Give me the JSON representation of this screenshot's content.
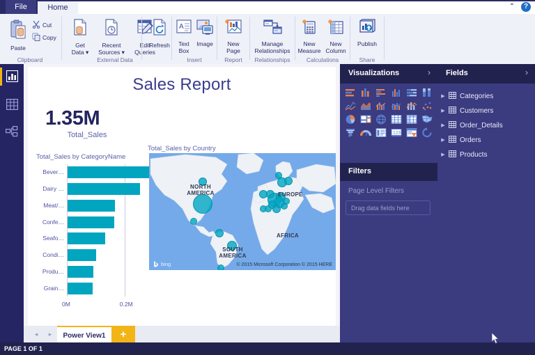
{
  "window": {
    "tabs": [
      {
        "label": "File",
        "name": "tab-file"
      },
      {
        "label": "Home",
        "name": "tab-home"
      }
    ],
    "collapse_icon": "chevron-up-icon",
    "collapse_glyph": "⌃",
    "help_icon": "help-icon",
    "help_glyph": "?"
  },
  "ribbon": {
    "groups": [
      {
        "label": "Clipboard",
        "commands": [
          {
            "label": "Paste",
            "icon": "paste-icon"
          },
          {
            "label": "Cut",
            "icon": "cut-icon"
          },
          {
            "label": "Copy",
            "icon": "copy-icon"
          }
        ]
      },
      {
        "label": "External Data",
        "commands": [
          {
            "label": "Get\nData ▾",
            "icon": "get-data-icon"
          },
          {
            "label": "Recent\nSources ▾",
            "icon": "recent-sources-icon"
          },
          {
            "label": "Edit\nQueries",
            "icon": "edit-queries-icon"
          },
          {
            "label": "Refresh",
            "icon": "refresh-icon"
          }
        ]
      },
      {
        "label": "Insert",
        "commands": [
          {
            "label": "Text\nBox",
            "icon": "text-box-icon"
          },
          {
            "label": "Image",
            "icon": "image-icon"
          }
        ]
      },
      {
        "label": "Report",
        "commands": [
          {
            "label": "New\nPage",
            "icon": "new-page-icon"
          }
        ]
      },
      {
        "label": "Relationships",
        "commands": [
          {
            "label": "Manage\nRelationships",
            "icon": "manage-relationships-icon"
          }
        ]
      },
      {
        "label": "Calculations",
        "commands": [
          {
            "label": "New\nMeasure",
            "icon": "new-measure-icon"
          },
          {
            "label": "New\nColumn",
            "icon": "new-column-icon"
          }
        ]
      },
      {
        "label": "Share",
        "commands": [
          {
            "label": "Publish",
            "icon": "publish-icon"
          }
        ]
      }
    ],
    "labels": {
      "paste": "Paste",
      "cut": "Cut",
      "copy": "Copy",
      "clipboard": "Clipboard",
      "get_data": "Get\nData ▾",
      "recent_sources": "Recent\nSources ▾",
      "edit_queries": "Edit\nQueries",
      "refresh": "Refresh",
      "external_data": "External Data",
      "text_box": "Text\nBox",
      "image": "Image",
      "insert": "Insert",
      "new_page": "New\nPage",
      "report": "Report",
      "manage_relationships": "Manage\nRelationships",
      "relationships": "Relationships",
      "new_measure": "New\nMeasure",
      "new_column": "New\nColumn",
      "calculations": "Calculations",
      "publish": "Publish",
      "share": "Share"
    }
  },
  "left_rail": {
    "items": [
      {
        "name": "report-view",
        "icon": "bar-chart-icon",
        "selected": true
      },
      {
        "name": "data-view",
        "icon": "table-icon",
        "selected": false
      },
      {
        "name": "relationships-view",
        "icon": "relationships-diagram-icon",
        "selected": false
      }
    ]
  },
  "report": {
    "title": "Sales Report",
    "kpi": {
      "value": "1.35M",
      "caption": "Total_Sales"
    },
    "map": {
      "title": "Total_Sales by Country",
      "bing_label": "bing",
      "attribution": "© 2015 Microsoft Corporation     © 2015 HERE",
      "continents": [
        "NORTH\nAMERICA",
        "SOUTH\nAMERICA",
        "AFRICA",
        "EUROPE"
      ]
    }
  },
  "chart_data": {
    "type": "bar",
    "orientation": "horizontal",
    "title": "Total_Sales by CategoryName",
    "xlabel": "",
    "ylabel": "",
    "categories": [
      "Bever…",
      "Dairy …",
      "Meat/…",
      "Confe…",
      "Seafo…",
      "Condi…",
      "Produ…",
      "Grain…"
    ],
    "full_categories": [
      "Beverages",
      "Dairy Products",
      "Meat/Poultry",
      "Confections",
      "Seafood",
      "Condiments",
      "Produce",
      "Grains/Cereals"
    ],
    "values": [
      0.286,
      0.251,
      0.164,
      0.163,
      0.131,
      0.1,
      0.089,
      0.086
    ],
    "value_unit": "M",
    "xlim": [
      0,
      0.29
    ],
    "tick_values": [
      0,
      0.2
    ],
    "tick_labels": [
      "0M",
      "0.2M"
    ],
    "grid": true,
    "bar_color": "#01a5c0",
    "series": [
      {
        "name": "Total_Sales",
        "values": [
          0.286,
          0.251,
          0.164,
          0.163,
          0.131,
          0.1,
          0.089,
          0.086
        ]
      }
    ]
  },
  "map_data": {
    "type": "scatter",
    "title": "Total_Sales by Country",
    "bubble_color": "#00a6c3",
    "bubbles": [
      {
        "x": 76,
        "y": 72,
        "r": 13,
        "region": "USA"
      },
      {
        "x": 76,
        "y": 40,
        "r": 5,
        "region": "Canada"
      },
      {
        "x": 63,
        "y": 97,
        "r": 4,
        "region": "Mexico"
      },
      {
        "x": 100,
        "y": 114,
        "r": 5,
        "region": "Venezuela"
      },
      {
        "x": 118,
        "y": 132,
        "r": 6,
        "region": "Brazil"
      },
      {
        "x": 102,
        "y": 164,
        "r": 4,
        "region": "Argentina"
      },
      {
        "x": 185,
        "y": 31,
        "r": 4,
        "region": "Norway"
      },
      {
        "x": 190,
        "y": 41,
        "r": 6,
        "region": "Sweden"
      },
      {
        "x": 199,
        "y": 39,
        "r": 5,
        "region": "Finland"
      },
      {
        "x": 163,
        "y": 58,
        "r": 5,
        "region": "Ireland"
      },
      {
        "x": 173,
        "y": 58,
        "r": 5,
        "region": "UK"
      },
      {
        "x": 179,
        "y": 66,
        "r": 9,
        "region": "Germany"
      },
      {
        "x": 188,
        "y": 62,
        "r": 6,
        "region": "Poland"
      },
      {
        "x": 186,
        "y": 70,
        "r": 7,
        "region": "Austria"
      },
      {
        "x": 176,
        "y": 73,
        "r": 5,
        "region": "France"
      },
      {
        "x": 163,
        "y": 79,
        "r": 4,
        "region": "Portugal"
      },
      {
        "x": 170,
        "y": 79,
        "r": 4,
        "region": "Spain"
      },
      {
        "x": 182,
        "y": 79,
        "r": 5,
        "region": "Italy"
      },
      {
        "x": 193,
        "y": 75,
        "r": 4,
        "region": "Switzerland"
      },
      {
        "x": 196,
        "y": 68,
        "r": 4,
        "region": "Belgium"
      }
    ]
  },
  "visualizations": {
    "title": "Visualizations",
    "collapse_glyph": "›",
    "icons": [
      "stacked-bar-chart-icon",
      "stacked-column-chart-icon",
      "clustered-bar-chart-icon",
      "clustered-column-chart-icon",
      "100-stacked-bar-chart-icon",
      "100-stacked-column-chart-icon",
      "line-chart-icon",
      "area-chart-icon",
      "stacked-area-chart-icon",
      "line-stacked-column-icon",
      "line-clustered-column-icon",
      "scatter-chart-icon",
      "pie-chart-icon",
      "treemap-icon",
      "map-icon",
      "filled-map-icon",
      "matrix-icon",
      "funnel-map-icon",
      "funnel-icon",
      "gauge-icon",
      "card-icon",
      "multi-row-card-icon",
      "slicer-icon",
      "r-visual-icon"
    ]
  },
  "filters": {
    "title": "Filters",
    "page_level_label": "Page Level Filters",
    "dropzone_placeholder": "Drag data fields here"
  },
  "fields": {
    "title": "Fields",
    "collapse_glyph": "›",
    "expand_glyph": "▶",
    "items": [
      {
        "label": "Categories",
        "icon": "table-icon"
      },
      {
        "label": "Customers",
        "icon": "table-icon"
      },
      {
        "label": "Order_Details",
        "icon": "table-icon"
      },
      {
        "label": "Orders",
        "icon": "table-icon"
      },
      {
        "label": "Products",
        "icon": "table-icon"
      }
    ]
  },
  "bottom": {
    "prev_glyph": "◂",
    "next_glyph": "▸",
    "page_tab": "Power View1",
    "add_glyph": "+",
    "status": "PAGE 1 OF 1"
  },
  "colors": {
    "accent_teal": "#01a5c0",
    "chrome_dark": "#22224f",
    "panel": "#3b3b80",
    "ribbon": "#eef1f8",
    "yellow": "#f2b417",
    "map_water": "#74aaea"
  }
}
